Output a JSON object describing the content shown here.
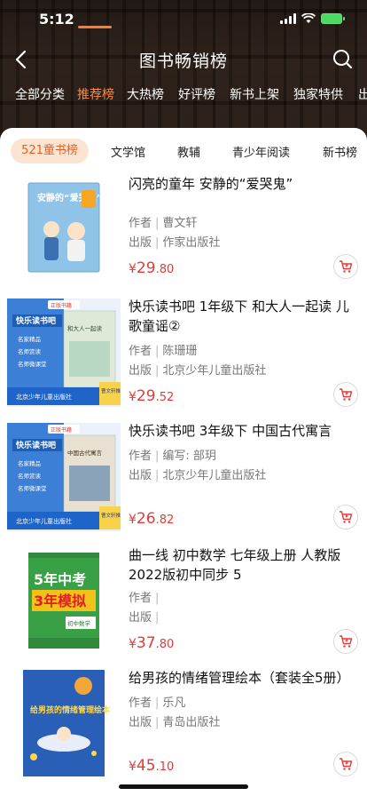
{
  "status": {
    "time": "5:12"
  },
  "nav": {
    "title": "图书畅销榜"
  },
  "category_tabs": [
    {
      "label": "全部分类"
    },
    {
      "label": "推荐榜"
    },
    {
      "label": "大热榜"
    },
    {
      "label": "好评榜"
    },
    {
      "label": "新书上架"
    },
    {
      "label": "独家特供"
    },
    {
      "label": "出"
    }
  ],
  "sub_tabs": [
    {
      "label": "521童书榜"
    },
    {
      "label": "文学馆"
    },
    {
      "label": "教辅"
    },
    {
      "label": "青少年阅读"
    },
    {
      "label": "新书榜"
    }
  ],
  "labels": {
    "author": "作者",
    "publisher": "出版",
    "edit_prefix": "编写: "
  },
  "books": [
    {
      "title": "闪亮的童年 安静的“爱哭鬼”",
      "author": "曹文轩",
      "publisher": "作家出版社",
      "price_currency": "¥",
      "price_int": "29",
      "price_dec": ".80",
      "cover_text": "安静的“爱哭鬼”",
      "cover_color": "#8fc3e8"
    },
    {
      "title": "快乐读书吧 1年级下 和大人一起读 儿歌童谣②",
      "author": "陈珊珊",
      "publisher": "北京少年儿童出版社",
      "price_currency": "¥",
      "price_int": "29",
      "price_dec": ".52",
      "cover_badge": "正版书籍",
      "cover_series": "快乐读书吧",
      "cover_lines": [
        "名家精品",
        "名师赏读",
        "名师微课堂"
      ],
      "cover_book_title": "和大人一起读",
      "cover_footer": "北京少年儿童出版社",
      "cover_recommend": "曹文轩推荐",
      "cover_color": "#2f6fcf"
    },
    {
      "title": "快乐读书吧 3年级下 中国古代寓言",
      "author_prefix": "编写: ",
      "author": "部玥",
      "publisher": "北京少年儿童出版社",
      "price_currency": "¥",
      "price_int": "26",
      "price_dec": ".82",
      "cover_badge": "正版书籍",
      "cover_series": "快乐读书吧",
      "cover_lines": [
        "名家精品",
        "名师赏读",
        "名师微课堂"
      ],
      "cover_book_title": "中国古代寓言",
      "cover_footer": "北京少年儿童出版社",
      "cover_recommend": "曹文轩推荐",
      "cover_color": "#2f6fcf"
    },
    {
      "title": "曲一线 初中数学 七年级上册 人教版 2022版初中同步 5",
      "author": "",
      "publisher": "",
      "price_currency": "¥",
      "price_int": "37",
      "price_dec": ".80",
      "cover_top": "5年中考",
      "cover_bottom": "3年模拟",
      "cover_subject": "初中数学",
      "cover_color": "#3aa046"
    },
    {
      "title": "给男孩的情绪管理绘本（套装全5册）",
      "author": "乐凡",
      "publisher": "青岛出版社",
      "price_currency": "¥",
      "price_int": "45",
      "price_dec": ".10",
      "cover_text": "给男孩的情绪管理绘本",
      "cover_color": "#2a5fb8"
    }
  ]
}
